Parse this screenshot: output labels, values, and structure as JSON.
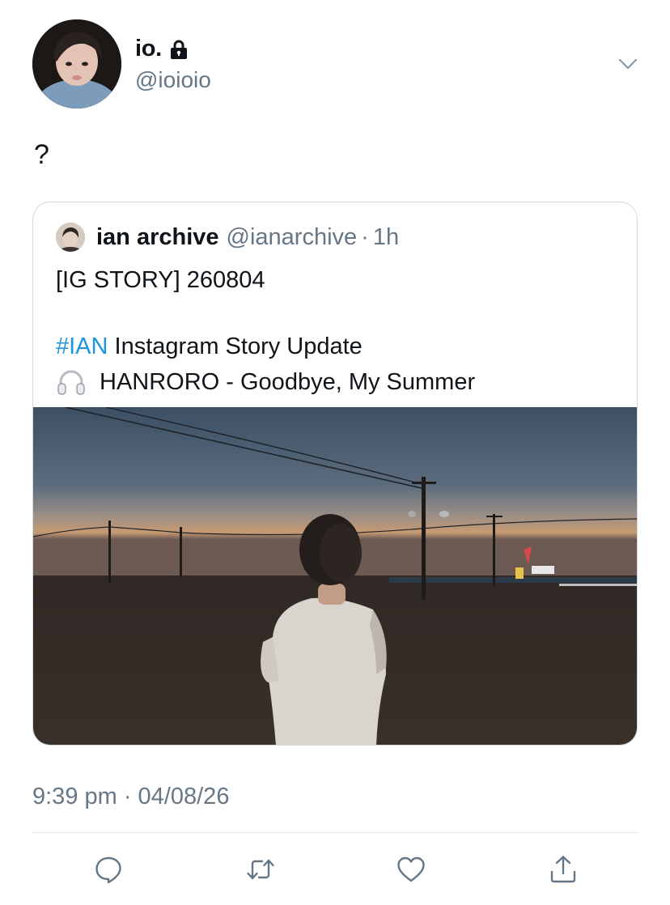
{
  "author": {
    "display_name": "io.",
    "handle": "@ioioio",
    "protected_icon": "lock-icon"
  },
  "tweet": {
    "text": "?"
  },
  "quoted": {
    "name": "ian archive",
    "handle": "@ianarchive",
    "separator": "·",
    "time": "1h",
    "line1": "[IG STORY] 260804",
    "hashtag": "#IAN",
    "line2_rest": " Instagram Story Update",
    "line3_icon": "headphones-icon",
    "line3": "HANRORO - Goodbye, My Summer"
  },
  "meta": {
    "timestamp": "9:39 pm · 04/08/26"
  },
  "actions": {
    "reply_icon": "reply-icon",
    "retweet_icon": "retweet-icon",
    "like_icon": "heart-icon",
    "share_icon": "share-icon"
  },
  "colors": {
    "link": "#1b95e0",
    "secondary": "#657786",
    "border": "#cfd9de"
  }
}
